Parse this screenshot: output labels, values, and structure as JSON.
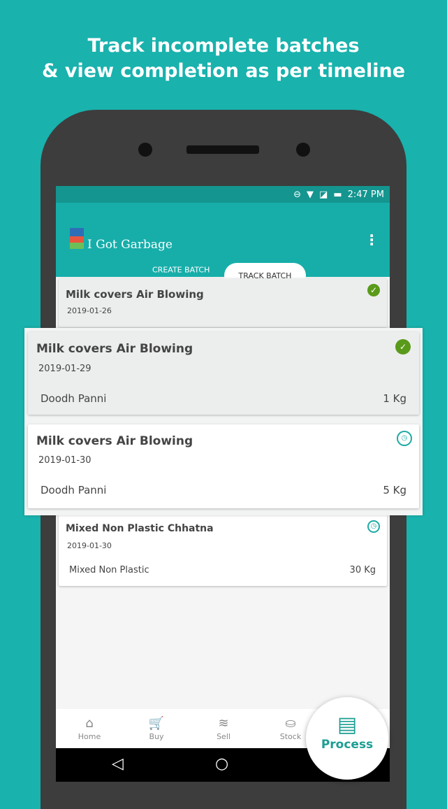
{
  "headline": {
    "line1": "Track incomplete batches",
    "line2": "& view completion as per timeline"
  },
  "status_bar": {
    "time": "2:47 PM"
  },
  "app": {
    "title": "I Got Garbage",
    "tabs": [
      {
        "label": "CREATE BATCH"
      },
      {
        "label": "TRACK BATCH",
        "selected": true
      }
    ]
  },
  "batches": [
    {
      "title": "Milk covers Air Blowing",
      "date": "2019-01-26",
      "status": "complete"
    },
    {
      "title": "Milk covers Air Blowing",
      "date": "2019-01-29",
      "item": "Doodh Panni",
      "weight": "1 Kg",
      "status": "complete"
    },
    {
      "title": "Milk covers Air Blowing",
      "date": "2019-01-30",
      "item": "Doodh Panni",
      "weight": "5 Kg",
      "status": "pending"
    },
    {
      "title": "Mixed Non Plastic Chhatna",
      "date": "2019-01-30",
      "item": "Mixed Non Plastic",
      "weight": "30 Kg",
      "status": "pending"
    }
  ],
  "bottom_nav": [
    {
      "label": "Home",
      "icon": "home-icon"
    },
    {
      "label": "Buy",
      "icon": "cart-icon"
    },
    {
      "label": "Sell",
      "icon": "coins-icon"
    },
    {
      "label": "Stock",
      "icon": "basket-icon"
    },
    {
      "label": "Process",
      "icon": "process-icon",
      "active": true
    }
  ],
  "colors": {
    "background": "#19b2ad",
    "appbar": "#17aeaa",
    "complete": "#5a9a1a",
    "pending": "#1eaaa3"
  }
}
